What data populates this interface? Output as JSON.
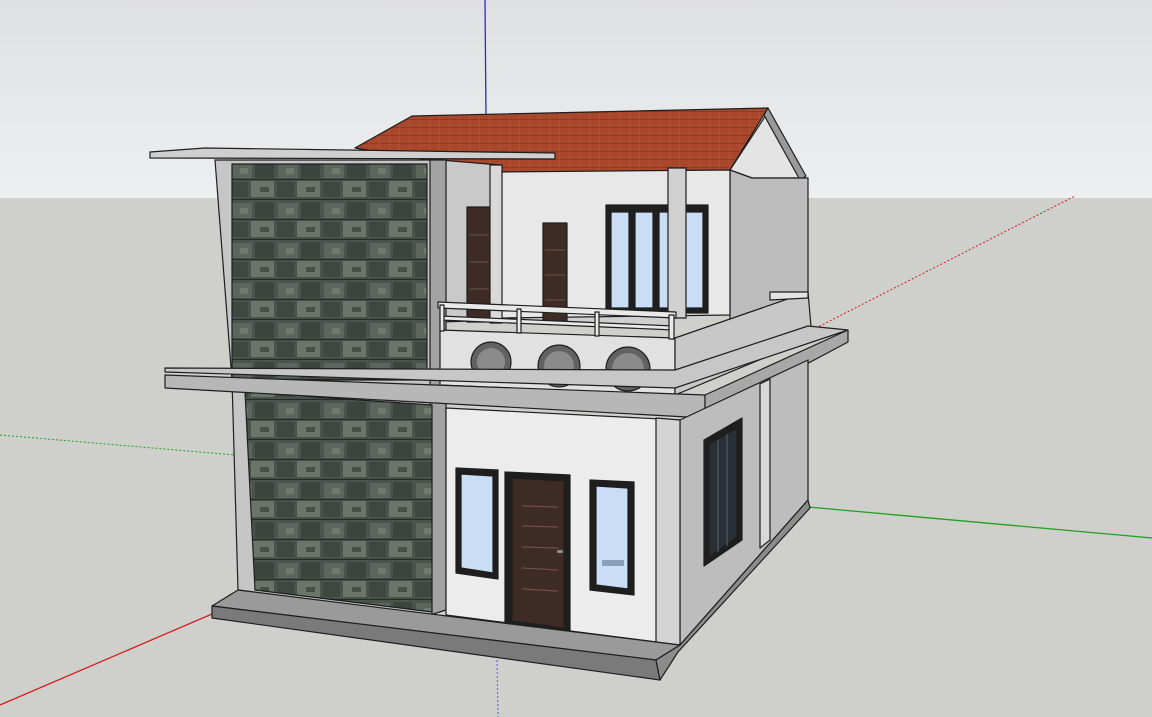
{
  "app": {
    "type": "3d-modeling-viewport"
  },
  "viewport": {
    "sky_color": "#e5e6e8",
    "ground_color": "#cfd0cc",
    "axes": {
      "red": "#d42020",
      "green": "#1fa01f",
      "blue": "#2a2ad0"
    }
  },
  "model": {
    "object": "two-storey-house",
    "colors": {
      "roof_tile": "#a9472c",
      "roof_tile_dark": "#8c3a24",
      "wall_white": "#ececec",
      "wall_gray": "#bcbcbc",
      "wall_side": "#9c9c9c",
      "slab": "#b4b4b4",
      "stone": "#48514a",
      "glass": "#c9ddf4",
      "door": "#3e2b25",
      "frame": "#1e1e1e",
      "base": "#7a7a7a"
    },
    "windows": {
      "upper_front_panes": 4,
      "ground_front": 2,
      "side": 1
    },
    "balcony_round_openings": 3
  }
}
